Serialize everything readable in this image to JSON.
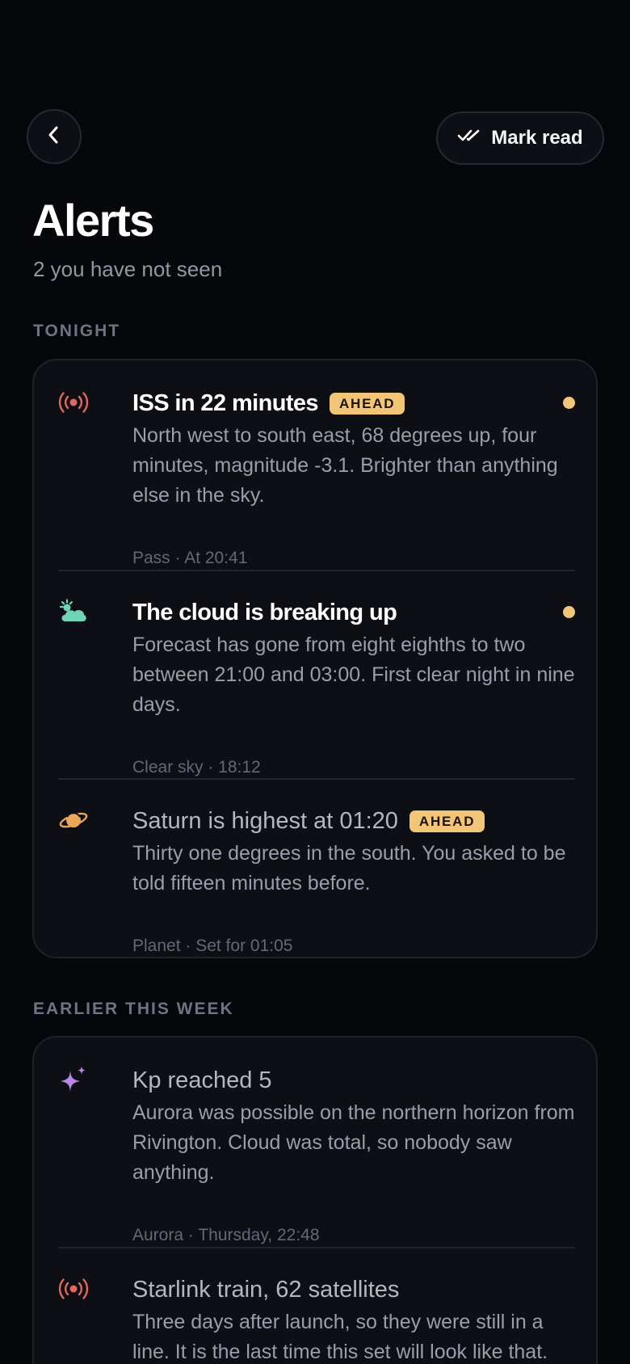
{
  "header": {
    "back_icon": "chevron-left-icon",
    "mark_read_icon": "double-check-icon",
    "mark_read_label": "Mark read",
    "title": "Alerts",
    "subtitle": "2 you have not seen"
  },
  "sections": [
    {
      "label": "TONIGHT",
      "items": [
        {
          "icon": "broadcast-icon",
          "icon_color": "#e2675f",
          "title": "ISS in 22 minutes",
          "badge": "AHEAD",
          "unread": true,
          "body": "North west to south east, 68 degrees up, four minutes, magnitude -3.1. Brighter than anything else in the sky.",
          "meta": "Pass · At 20:41"
        },
        {
          "icon": "cloud-sun-icon",
          "icon_color": "#6dd4b5",
          "title": "The cloud is breaking up",
          "unread": true,
          "body": "Forecast has gone from eight eighths to two between 21:00 and 03:00. First clear night in nine days.",
          "meta": "Clear sky · 18:12"
        },
        {
          "icon": "planet-icon",
          "icon_color": "#e7a85a",
          "title": "Saturn is highest at 01:20",
          "badge": "AHEAD",
          "unread": false,
          "body": "Thirty one degrees in the south. You asked to be told fifteen minutes before.",
          "meta": "Planet · Set for 01:05"
        }
      ]
    },
    {
      "label": "EARLIER THIS WEEK",
      "items": [
        {
          "icon": "sparkle-icon",
          "icon_color": "#b887e8",
          "title": "Kp reached 5",
          "unread": false,
          "body": "Aurora was possible on the northern horizon from Rivington. Cloud was total, so nobody saw anything.",
          "meta": "Aurora · Thursday, 22:48"
        },
        {
          "icon": "broadcast-icon",
          "icon_color": "#e2675f",
          "title": "Starlink train, 62 satellites",
          "unread": false,
          "body": "Three days after launch, so they were still in a line. It is the last time this set will look like that."
        }
      ]
    }
  ],
  "colors": {
    "background": "#06070a",
    "card": "#0e0f14",
    "accent": "#f3c677"
  }
}
